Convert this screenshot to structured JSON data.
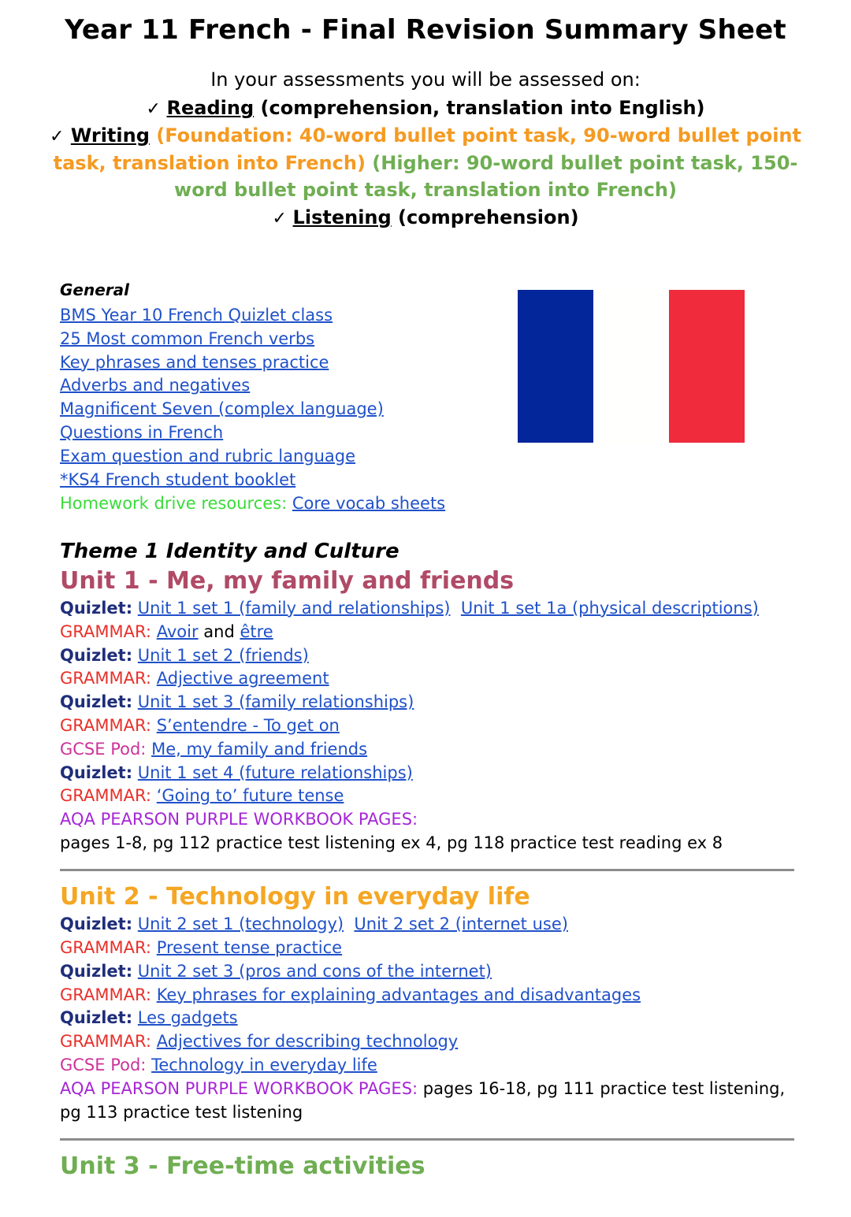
{
  "document": {
    "title": "Year 11 French - Final Revision Summary Sheet",
    "intro_lead": "In your assessments you will be assessed on:",
    "assessment": {
      "tick": "✓",
      "reading_label": "Reading",
      "reading_detail": " (comprehension, translation into English)",
      "writing_label": "Writing",
      "writing_foundation": " (Foundation: 40-word bullet point task, 90-word bullet point task, translation into French)",
      "writing_higher": " (Higher: 90-word bullet point task, 150-word bullet point task, translation into French)",
      "listening_label": "Listening",
      "listening_detail": " (comprehension)"
    }
  },
  "general": {
    "heading": "General",
    "links": [
      "BMS Year 10 French Quizlet class",
      "25 Most common French verbs",
      "Key phrases and tenses practice",
      "Adverbs and negatives",
      "Magnificent Seven (complex language)",
      "Questions in French",
      "Exam question and rubric language",
      "*KS4 French student booklet"
    ],
    "homework_label": "Homework drive resources:",
    "homework_link": "Core vocab sheets"
  },
  "flag": {
    "name": "french-flag",
    "blue": "#04269B",
    "white": "#FFFFFE",
    "red": "#EF2B3C"
  },
  "theme": {
    "heading": "Theme 1  Identity and Culture"
  },
  "labels": {
    "quizlet": "Quizlet:",
    "grammar": "GRAMMAR:",
    "gcsepod": "GCSE Pod:",
    "aqa": "AQA PEARSON PURPLE WORKBOOK PAGES:"
  },
  "units": [
    {
      "heading": "Unit 1 - Me, my family and friends",
      "color": "#B04A66",
      "rows": [
        {
          "label": "quizlet",
          "links": [
            "Unit 1 set 1 (family and relationships)",
            "Unit 1 set 1a (physical descriptions)"
          ]
        },
        {
          "label": "grammar",
          "links": [
            "Avoir"
          ],
          "mid_text": " and ",
          "links2": [
            "être"
          ]
        },
        {
          "label": "quizlet",
          "links": [
            "Unit 1 set 2 (friends)"
          ]
        },
        {
          "label": "grammar",
          "links": [
            "Adjective agreement"
          ]
        },
        {
          "label": "quizlet",
          "links": [
            "Unit 1 set 3 (family relationships)"
          ]
        },
        {
          "label": "grammar",
          "links": [
            "S’entendre - To get on"
          ]
        },
        {
          "label": "gcsepod",
          "links": [
            "Me, my family and friends"
          ]
        },
        {
          "label": "quizlet",
          "links": [
            "Unit 1 set 4 (future relationships)"
          ]
        },
        {
          "label": "grammar",
          "links": [
            "‘Going to’ future tense"
          ]
        },
        {
          "label": "aqa",
          "links": []
        },
        {
          "label": "none",
          "plain": "pages 1-8, pg 112 practice test listening ex 4, pg 118 practice test reading ex 8"
        }
      ]
    },
    {
      "heading": "Unit 2 - Technology in everyday life",
      "color": "#F5A623",
      "rows": [
        {
          "label": "quizlet",
          "links": [
            "Unit 2 set 1 (technology)",
            "Unit 2 set 2 (internet use)"
          ]
        },
        {
          "label": "grammar",
          "links": [
            "Present tense practice"
          ]
        },
        {
          "label": "quizlet",
          "links": [
            "Unit 2 set 3 (pros and cons of the internet)"
          ]
        },
        {
          "label": "grammar",
          "links": [
            "Key phrases for explaining advantages and disadvantages"
          ]
        },
        {
          "label": "quizlet",
          "links": [
            "Les gadgets"
          ]
        },
        {
          "label": "grammar",
          "links": [
            "Adjectives for describing technology"
          ]
        },
        {
          "label": "gcsepod",
          "links": [
            "Technology in everyday life"
          ]
        },
        {
          "label": "aqa",
          "plain": " pages 16-18, pg 111 practice test listening, pg 113 practice test listening"
        }
      ]
    },
    {
      "heading": "Unit 3 - Free-time activities",
      "color": "#6FAE52",
      "rows": []
    }
  ]
}
